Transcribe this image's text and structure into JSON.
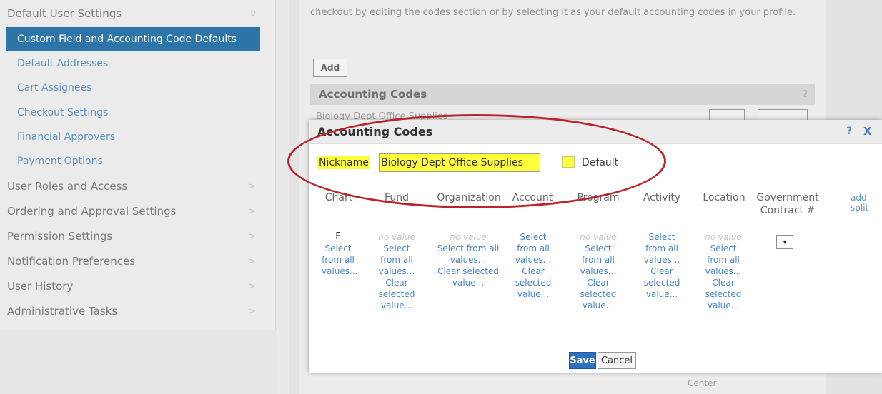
{
  "sidebar": {
    "items": [
      {
        "label": "Default User Settings",
        "type": "header",
        "chevron": "v"
      },
      {
        "label": "Custom Field and Accounting Code Defaults",
        "type": "active"
      },
      {
        "label": "Default Addresses",
        "type": "sub"
      },
      {
        "label": "Cart Assignees",
        "type": "sub"
      },
      {
        "label": "Checkout Settings",
        "type": "sub"
      },
      {
        "label": "Financial Approvers",
        "type": "sub"
      },
      {
        "label": "Payment Options",
        "type": "sub"
      },
      {
        "label": "User Roles and Access",
        "type": "section",
        "chevron": ">"
      },
      {
        "label": "Ordering and Approval Settings",
        "type": "section",
        "chevron": ">"
      },
      {
        "label": "Permission Settings",
        "type": "section",
        "chevron": ">"
      },
      {
        "label": "Notification Preferences",
        "type": "section",
        "chevron": ">"
      },
      {
        "label": "User History",
        "type": "section",
        "chevron": ">"
      },
      {
        "label": "Administrative Tasks",
        "type": "section",
        "chevron": ">"
      }
    ]
  },
  "background": {
    "intro_text": "checkout by editing the codes section or by selecting it as your default accounting codes in your profile.",
    "add_label": "Add",
    "section_title": "Accounting Codes",
    "help_glyph": "?",
    "partial_row_text": "Biology Dept Office Supplies",
    "center_text": "Center"
  },
  "modal": {
    "title": "Accounting Codes",
    "help_glyph": "?",
    "close_glyph": "X",
    "nickname_label": "Nickname",
    "nickname_value": "Biology Dept Office Supplies",
    "default_label": "Default",
    "columns": [
      "Chart",
      "Fund",
      "Organization",
      "Account",
      "Program",
      "Activity",
      "Location",
      "Government Contract #"
    ],
    "add_split": "add split",
    "cells": {
      "chart": {
        "value": "F",
        "lines": [
          "Select",
          "from all",
          "values..."
        ]
      },
      "fund": {
        "no_value": "no value",
        "lines": [
          "Select",
          "from all",
          "values...",
          "Clear",
          "selected",
          "value..."
        ]
      },
      "organization": {
        "no_value": "no value",
        "lines": [
          "Select from all",
          "values...",
          "Clear selected",
          "value..."
        ]
      },
      "account": {
        "lines": [
          "Select",
          "from all",
          "values...",
          "Clear",
          "selected",
          "value..."
        ]
      },
      "program": {
        "no_value": "no value",
        "lines": [
          "Select",
          "from all",
          "values...",
          "Clear",
          "selected",
          "value..."
        ]
      },
      "activity": {
        "lines": [
          "Select",
          "from all",
          "values...",
          "Clear",
          "selected",
          "value..."
        ]
      },
      "location": {
        "no_value": "no value",
        "lines": [
          "Select",
          "from all",
          "values...",
          "Clear",
          "selected",
          "value..."
        ]
      }
    },
    "gov_select_glyph": "▾",
    "save_label": "Save",
    "cancel_label": "Cancel"
  },
  "colors": {
    "accent": "#2d74a9",
    "link": "#4a86c5",
    "highlight": "#ffff3a",
    "annotation": "#b8262c"
  }
}
